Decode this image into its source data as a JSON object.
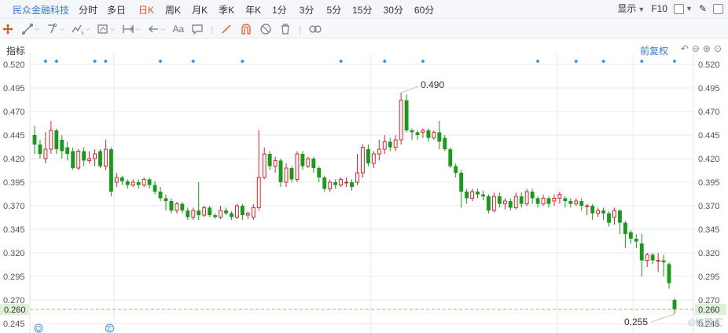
{
  "header": {
    "stock_name": "民众金融科技",
    "periods": [
      "分时",
      "多日",
      "日K",
      "周K",
      "月K",
      "季K",
      "年K",
      "1分",
      "3分",
      "5分",
      "15分",
      "30分",
      "60分"
    ],
    "active_period": "日K",
    "display_label": "显示",
    "f10_label": "F10"
  },
  "indicator": {
    "label": "指标",
    "adjust_label": "前复权"
  },
  "watermark": "©格隆汇",
  "chart_data": {
    "type": "candlestick",
    "y_ticks": [
      "0.520",
      "0.495",
      "0.470",
      "0.445",
      "0.420",
      "0.395",
      "0.370",
      "0.345",
      "0.320",
      "0.295",
      "0.270",
      "0.245"
    ],
    "ylim": [
      0.245,
      0.52
    ],
    "current_price": "0.260",
    "max_label": "0.490",
    "min_label": "0.255",
    "colors": {
      "up": "#e0202a",
      "down": "#1a9a1a",
      "grid": "#e3ebf5",
      "text": "#555555",
      "current": "#e8a040",
      "event": "#3a8ee6"
    },
    "candles": [
      [
        0.445,
        0.435,
        0.455,
        0.425
      ],
      [
        0.435,
        0.425,
        0.44,
        0.42
      ],
      [
        0.42,
        0.43,
        0.448,
        0.415
      ],
      [
        0.43,
        0.45,
        0.46,
        0.425
      ],
      [
        0.45,
        0.43,
        0.452,
        0.425
      ],
      [
        0.44,
        0.428,
        0.445,
        0.42
      ],
      [
        0.432,
        0.425,
        0.438,
        0.418
      ],
      [
        0.428,
        0.41,
        0.432,
        0.408
      ],
      [
        0.41,
        0.428,
        0.43,
        0.408
      ],
      [
        0.428,
        0.418,
        0.432,
        0.412
      ],
      [
        0.418,
        0.42,
        0.428,
        0.415
      ],
      [
        0.42,
        0.425,
        0.43,
        0.412
      ],
      [
        0.428,
        0.412,
        0.43,
        0.41
      ],
      [
        0.412,
        0.43,
        0.44,
        0.408
      ],
      [
        0.43,
        0.385,
        0.432,
        0.38
      ],
      [
        0.395,
        0.4,
        0.405,
        0.39
      ],
      [
        0.4,
        0.396,
        0.402,
        0.392
      ],
      [
        0.396,
        0.392,
        0.398,
        0.388
      ],
      [
        0.392,
        0.395,
        0.398,
        0.39
      ],
      [
        0.395,
        0.392,
        0.398,
        0.388
      ],
      [
        0.392,
        0.398,
        0.4,
        0.39
      ],
      [
        0.398,
        0.392,
        0.4,
        0.388
      ],
      [
        0.392,
        0.385,
        0.396,
        0.382
      ],
      [
        0.385,
        0.378,
        0.39,
        0.375
      ],
      [
        0.378,
        0.375,
        0.382,
        0.365
      ],
      [
        0.375,
        0.365,
        0.378,
        0.362
      ],
      [
        0.365,
        0.372,
        0.374,
        0.362
      ],
      [
        0.372,
        0.365,
        0.374,
        0.362
      ],
      [
        0.365,
        0.358,
        0.368,
        0.355
      ],
      [
        0.358,
        0.365,
        0.368,
        0.355
      ],
      [
        0.365,
        0.36,
        0.395,
        0.355
      ],
      [
        0.36,
        0.368,
        0.37,
        0.358
      ],
      [
        0.368,
        0.36,
        0.37,
        0.358
      ],
      [
        0.36,
        0.358,
        0.362,
        0.356
      ],
      [
        0.358,
        0.365,
        0.37,
        0.356
      ],
      [
        0.365,
        0.362,
        0.368,
        0.36
      ],
      [
        0.362,
        0.358,
        0.364,
        0.355
      ],
      [
        0.358,
        0.37,
        0.372,
        0.356
      ],
      [
        0.37,
        0.36,
        0.372,
        0.355
      ],
      [
        0.36,
        0.362,
        0.364,
        0.356
      ],
      [
        0.358,
        0.368,
        0.372,
        0.355
      ],
      [
        0.368,
        0.4,
        0.45,
        0.365
      ],
      [
        0.4,
        0.425,
        0.432,
        0.398
      ],
      [
        0.425,
        0.412,
        0.428,
        0.408
      ],
      [
        0.412,
        0.418,
        0.422,
        0.405
      ],
      [
        0.418,
        0.395,
        0.42,
        0.39
      ],
      [
        0.395,
        0.41,
        0.415,
        0.39
      ],
      [
        0.41,
        0.398,
        0.412,
        0.395
      ],
      [
        0.398,
        0.425,
        0.428,
        0.395
      ],
      [
        0.425,
        0.412,
        0.428,
        0.408
      ],
      [
        0.412,
        0.42,
        0.422,
        0.41
      ],
      [
        0.42,
        0.41,
        0.422,
        0.405
      ],
      [
        0.41,
        0.4,
        0.412,
        0.395
      ],
      [
        0.4,
        0.388,
        0.402,
        0.385
      ],
      [
        0.388,
        0.395,
        0.398,
        0.385
      ],
      [
        0.395,
        0.392,
        0.398,
        0.388
      ],
      [
        0.392,
        0.398,
        0.4,
        0.39
      ],
      [
        0.395,
        0.395,
        0.4,
        0.39
      ],
      [
        0.395,
        0.39,
        0.398,
        0.386
      ],
      [
        0.395,
        0.405,
        0.425,
        0.392
      ],
      [
        0.405,
        0.432,
        0.435,
        0.4
      ],
      [
        0.43,
        0.415,
        0.435,
        0.412
      ],
      [
        0.415,
        0.425,
        0.428,
        0.41
      ],
      [
        0.425,
        0.43,
        0.44,
        0.418
      ],
      [
        0.43,
        0.438,
        0.445,
        0.425
      ],
      [
        0.438,
        0.432,
        0.442,
        0.428
      ],
      [
        0.432,
        0.44,
        0.445,
        0.428
      ],
      [
        0.44,
        0.482,
        0.49,
        0.435
      ],
      [
        0.482,
        0.45,
        0.488,
        0.448
      ],
      [
        0.45,
        0.448,
        0.452,
        0.44
      ],
      [
        0.448,
        0.445,
        0.45,
        0.44
      ],
      [
        0.448,
        0.45,
        0.452,
        0.442
      ],
      [
        0.45,
        0.442,
        0.452,
        0.438
      ],
      [
        0.442,
        0.448,
        0.45,
        0.44
      ],
      [
        0.448,
        0.438,
        0.46,
        0.43
      ],
      [
        0.442,
        0.43,
        0.445,
        0.428
      ],
      [
        0.43,
        0.412,
        0.432,
        0.41
      ],
      [
        0.412,
        0.405,
        0.415,
        0.4
      ],
      [
        0.405,
        0.385,
        0.408,
        0.368
      ],
      [
        0.385,
        0.378,
        0.388,
        0.372
      ],
      [
        0.378,
        0.385,
        0.388,
        0.375
      ],
      [
        0.385,
        0.382,
        0.388,
        0.378
      ],
      [
        0.382,
        0.38,
        0.386,
        0.376
      ],
      [
        0.38,
        0.365,
        0.382,
        0.362
      ],
      [
        0.365,
        0.38,
        0.384,
        0.363
      ],
      [
        0.38,
        0.372,
        0.384,
        0.368
      ],
      [
        0.372,
        0.375,
        0.378,
        0.366
      ],
      [
        0.375,
        0.368,
        0.378,
        0.365
      ],
      [
        0.368,
        0.38,
        0.384,
        0.366
      ],
      [
        0.38,
        0.372,
        0.384,
        0.368
      ],
      [
        0.372,
        0.385,
        0.388,
        0.37
      ],
      [
        0.385,
        0.378,
        0.388,
        0.372
      ],
      [
        0.378,
        0.372,
        0.38,
        0.368
      ],
      [
        0.372,
        0.378,
        0.382,
        0.37
      ],
      [
        0.378,
        0.372,
        0.38,
        0.368
      ],
      [
        0.375,
        0.378,
        0.382,
        0.37
      ],
      [
        0.378,
        0.382,
        0.385,
        0.372
      ],
      [
        0.378,
        0.375,
        0.38,
        0.368
      ],
      [
        0.375,
        0.372,
        0.378,
        0.368
      ],
      [
        0.372,
        0.375,
        0.378,
        0.37
      ],
      [
        0.375,
        0.37,
        0.378,
        0.365
      ],
      [
        0.37,
        0.37,
        0.372,
        0.36
      ],
      [
        0.37,
        0.362,
        0.372,
        0.355
      ],
      [
        0.362,
        0.365,
        0.368,
        0.358
      ],
      [
        0.365,
        0.362,
        0.368,
        0.355
      ],
      [
        0.362,
        0.352,
        0.364,
        0.348
      ],
      [
        0.358,
        0.365,
        0.368,
        0.35
      ],
      [
        0.365,
        0.352,
        0.366,
        0.34
      ],
      [
        0.352,
        0.34,
        0.354,
        0.325
      ],
      [
        0.342,
        0.335,
        0.344,
        0.33
      ],
      [
        0.335,
        0.332,
        0.34,
        0.325
      ],
      [
        0.33,
        0.312,
        0.34,
        0.295
      ],
      [
        0.312,
        0.318,
        0.32,
        0.305
      ],
      [
        0.318,
        0.312,
        0.32,
        0.308
      ],
      [
        0.312,
        0.312,
        0.32,
        0.3
      ],
      [
        0.312,
        0.31,
        0.318,
        0.295
      ],
      [
        0.308,
        0.288,
        0.31,
        0.282
      ],
      [
        0.27,
        0.26,
        0.272,
        0.255
      ]
    ],
    "event_markers": [
      2,
      4,
      11,
      13,
      23,
      29,
      38,
      56,
      64,
      71,
      92,
      99,
      104,
      111,
      117
    ],
    "time_separators": [
      14,
      61,
      95,
      109
    ],
    "bottom_markers": [
      {
        "index": 0,
        "symbol": "Q"
      },
      {
        "index": 13,
        "symbol": "E"
      }
    ]
  }
}
